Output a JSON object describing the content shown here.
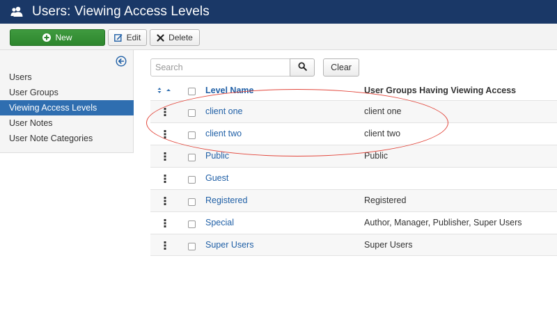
{
  "header": {
    "title": "Users: Viewing Access Levels",
    "icon": "users-icon"
  },
  "toolbar": {
    "new_label": "New",
    "edit_label": "Edit",
    "delete_label": "Delete"
  },
  "sidebar": {
    "items": [
      {
        "label": "Users",
        "active": false
      },
      {
        "label": "User Groups",
        "active": false
      },
      {
        "label": "Viewing Access Levels",
        "active": true
      },
      {
        "label": "User Notes",
        "active": false
      },
      {
        "label": "User Note Categories",
        "active": false
      }
    ]
  },
  "search": {
    "placeholder": "Search",
    "value": "",
    "clear_label": "Clear"
  },
  "table": {
    "columns": {
      "name": "Level Name",
      "groups": "User Groups Having Viewing Access"
    },
    "rows": [
      {
        "name": "client one",
        "groups": "client one"
      },
      {
        "name": "client two",
        "groups": "client two"
      },
      {
        "name": "Public",
        "groups": "Public"
      },
      {
        "name": "Guest",
        "groups": ""
      },
      {
        "name": "Registered",
        "groups": "Registered"
      },
      {
        "name": "Special",
        "groups": "Author, Manager, Publisher, Super Users"
      },
      {
        "name": "Super Users",
        "groups": "Super Users"
      }
    ]
  },
  "colors": {
    "header_bg": "#1a3867",
    "new_button": "#2d862d",
    "sidebar_active": "#2f6eb0",
    "link": "#1f5fa6",
    "annotation": "#e2463b"
  }
}
